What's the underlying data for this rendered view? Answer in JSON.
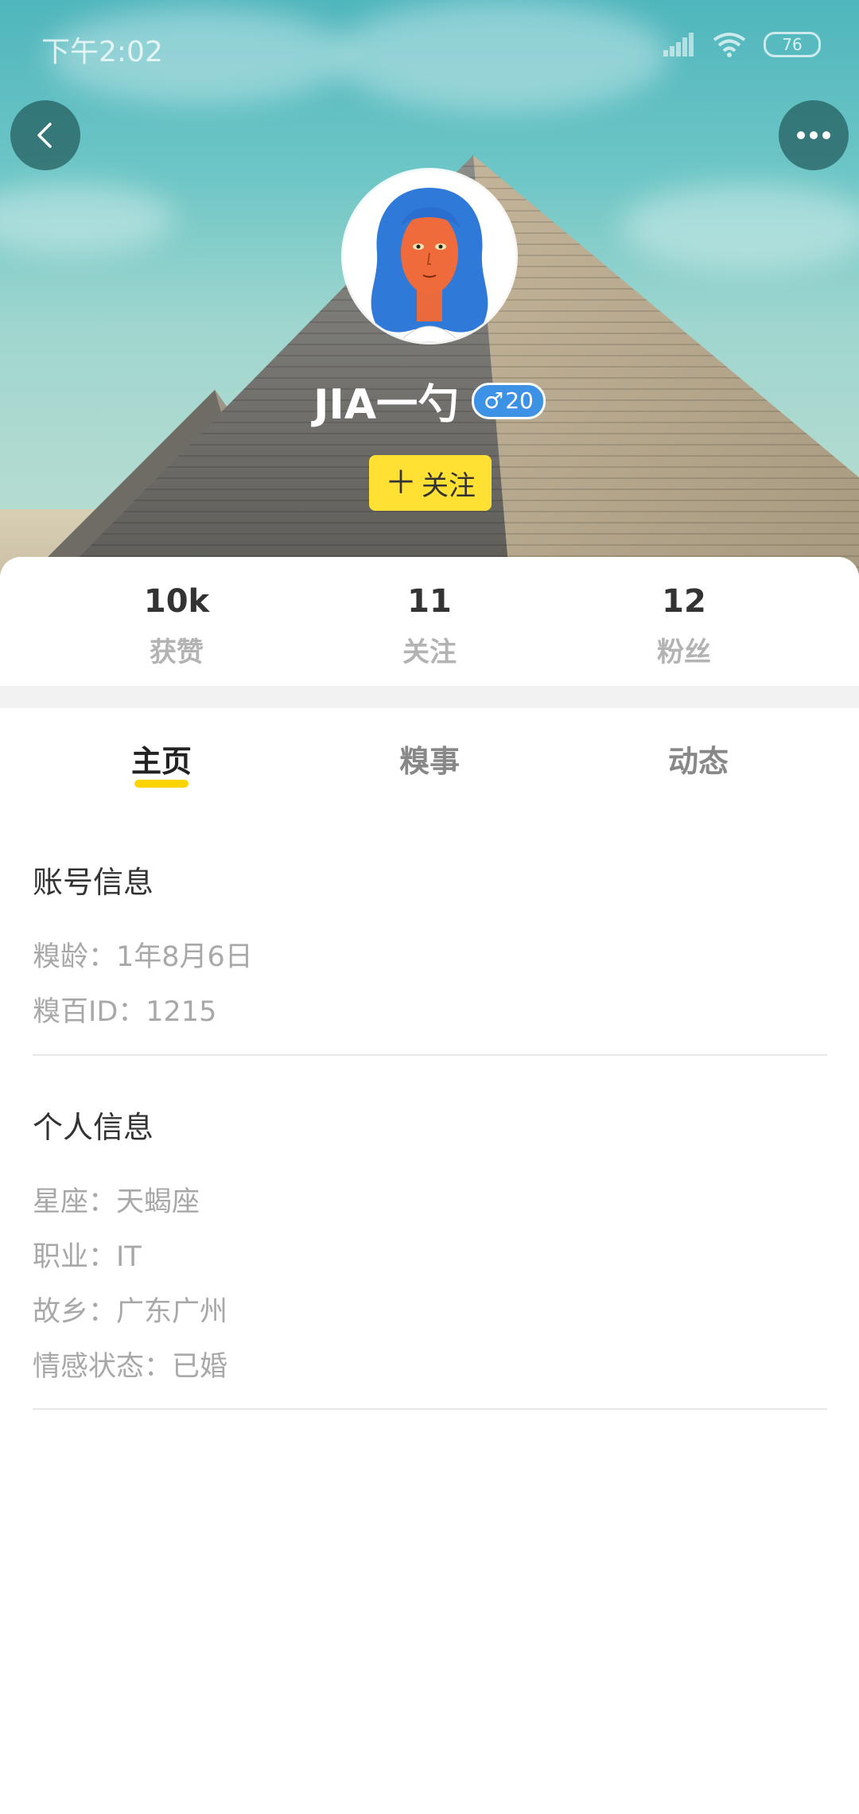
{
  "status_bar": {
    "time": "下午2:02",
    "battery": "76",
    "icons": [
      "signal-icon",
      "wifi-icon",
      "battery-icon"
    ]
  },
  "header": {
    "back_icon": "chevron-left-icon",
    "more_icon": "more-dots-icon",
    "user_name": "JIA一勺",
    "gender_symbol": "♂",
    "age": "20",
    "follow_plus": "＋",
    "follow_label": "关注",
    "colors": {
      "follow_button": "#ffe033",
      "gender_badge": "#3e92e6"
    }
  },
  "stats": [
    {
      "value": "10k",
      "label": "获赞"
    },
    {
      "value": "11",
      "label": "关注"
    },
    {
      "value": "12",
      "label": "粉丝"
    }
  ],
  "tabs": [
    {
      "label": "主页",
      "active": true
    },
    {
      "label": "糗事",
      "active": false
    },
    {
      "label": "动态",
      "active": false
    }
  ],
  "account_info": {
    "title": "账号信息",
    "lines": [
      "糗龄：1年8月6日",
      "糗百ID：1215"
    ]
  },
  "personal_info": {
    "title": "个人信息",
    "lines": [
      "星座：天蝎座",
      "职业：IT",
      "故乡：广东广州",
      "情感状态：已婚"
    ]
  },
  "accent_color": "#ffd400"
}
